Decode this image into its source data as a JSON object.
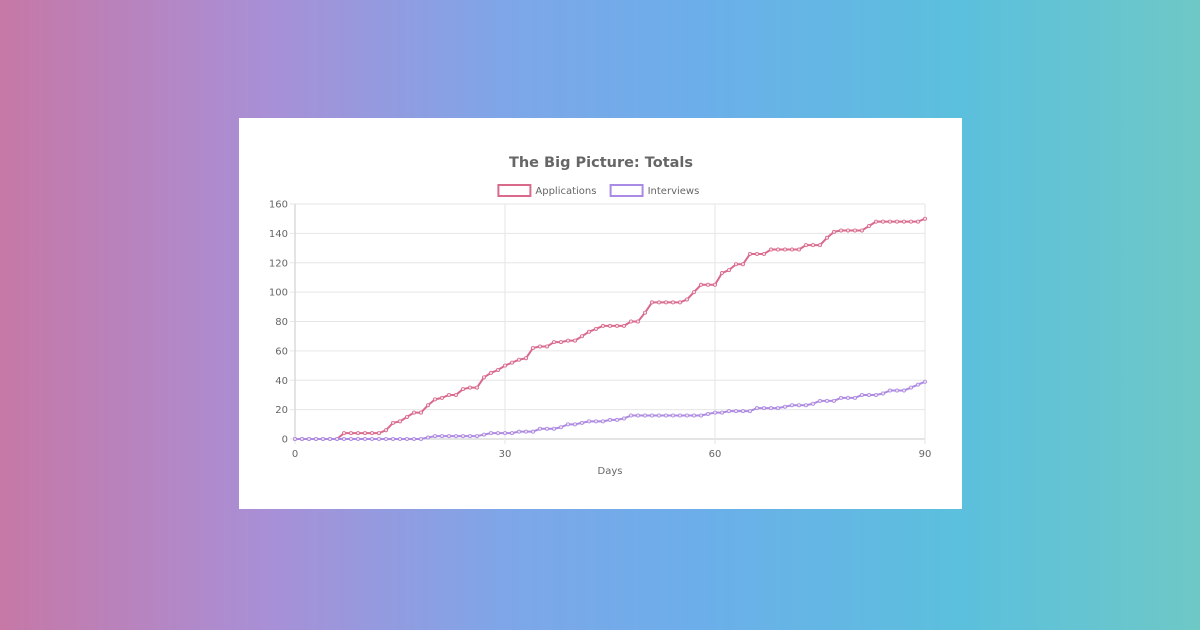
{
  "chart_data": {
    "type": "line",
    "title": "The Big Picture: Totals",
    "xlabel": "Days",
    "ylabel": "",
    "xlim": [
      0,
      90
    ],
    "ylim": [
      0,
      160
    ],
    "x_ticks": [
      0,
      30,
      60,
      90
    ],
    "y_ticks": [
      0,
      20,
      40,
      60,
      80,
      100,
      120,
      140,
      160
    ],
    "grid": true,
    "legend_position": "top",
    "x": [
      0,
      1,
      2,
      3,
      4,
      5,
      6,
      7,
      8,
      9,
      10,
      11,
      12,
      13,
      14,
      15,
      16,
      17,
      18,
      19,
      20,
      21,
      22,
      23,
      24,
      25,
      26,
      27,
      28,
      29,
      30,
      31,
      32,
      33,
      34,
      35,
      36,
      37,
      38,
      39,
      40,
      41,
      42,
      43,
      44,
      45,
      46,
      47,
      48,
      49,
      50,
      51,
      52,
      53,
      54,
      55,
      56,
      57,
      58,
      59,
      60,
      61,
      62,
      63,
      64,
      65,
      66,
      67,
      68,
      69,
      70,
      71,
      72,
      73,
      74,
      75,
      76,
      77,
      78,
      79,
      80,
      81,
      82,
      83,
      84,
      85,
      86,
      87,
      88,
      89,
      90
    ],
    "series": [
      {
        "name": "Applications",
        "color": "#d96a8c",
        "values": [
          0,
          0,
          0,
          0,
          0,
          0,
          0,
          4,
          4,
          4,
          4,
          4,
          4,
          6,
          11,
          12,
          15,
          18,
          18,
          23,
          27,
          28,
          30,
          30,
          34,
          35,
          35,
          42,
          45,
          47,
          50,
          52,
          54,
          55,
          62,
          63,
          63,
          66,
          66,
          67,
          67,
          70,
          73,
          75,
          77,
          77,
          77,
          77,
          80,
          80,
          86,
          93,
          93,
          93,
          93,
          93,
          95,
          100,
          105,
          105,
          105,
          113,
          115,
          119,
          119,
          126,
          126,
          126,
          129,
          129,
          129,
          129,
          129,
          132,
          132,
          132,
          137,
          141,
          142,
          142,
          142,
          142,
          145,
          148,
          148,
          148,
          148,
          148,
          148,
          148,
          150
        ]
      },
      {
        "name": "Interviews",
        "color": "#a98be6",
        "values": [
          0,
          0,
          0,
          0,
          0,
          0,
          0,
          0,
          0,
          0,
          0,
          0,
          0,
          0,
          0,
          0,
          0,
          0,
          0,
          1,
          2,
          2,
          2,
          2,
          2,
          2,
          2,
          3,
          4,
          4,
          4,
          4,
          5,
          5,
          5,
          7,
          7,
          7,
          8,
          10,
          10,
          11,
          12,
          12,
          12,
          13,
          13,
          14,
          16,
          16,
          16,
          16,
          16,
          16,
          16,
          16,
          16,
          16,
          16,
          17,
          18,
          18,
          19,
          19,
          19,
          19,
          21,
          21,
          21,
          21,
          22,
          23,
          23,
          23,
          24,
          26,
          26,
          26,
          28,
          28,
          28,
          30,
          30,
          30,
          31,
          33,
          33,
          33,
          35,
          37,
          39
        ]
      }
    ]
  }
}
